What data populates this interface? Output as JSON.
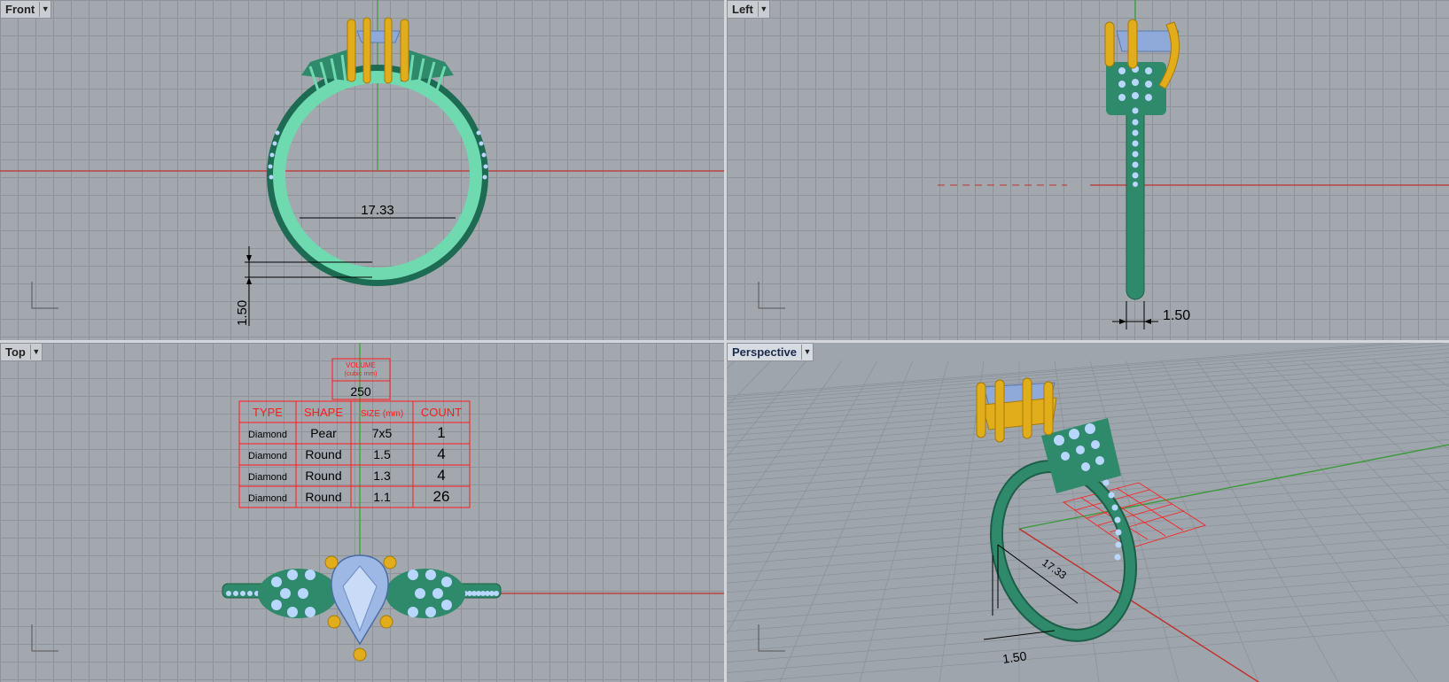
{
  "viewports": {
    "front": {
      "label": "Front",
      "dim_width": "17.33",
      "dim_thickness": "1.50"
    },
    "left": {
      "label": "Left",
      "dim_thickness": "1.50"
    },
    "top": {
      "label": "Top"
    },
    "perspective": {
      "label": "Perspective",
      "dim_width": "17.33",
      "dim_thickness": "1.50"
    }
  },
  "volume_box": {
    "title": "VOLUME",
    "unit": "(cubic mm)",
    "value": "250"
  },
  "stone_table": {
    "headers": [
      "TYPE",
      "SHAPE",
      "SIZE (mm)",
      "COUNT"
    ],
    "rows": [
      [
        "Diamond",
        "Pear",
        "7x5",
        "1"
      ],
      [
        "Diamond",
        "Round",
        "1.5",
        "4"
      ],
      [
        "Diamond",
        "Round",
        "1.3",
        "4"
      ],
      [
        "Diamond",
        "Round",
        "1.1",
        "26"
      ]
    ]
  },
  "colors": {
    "band": "#2e8a6a",
    "band_light": "#6fd9b0",
    "prong": "#e2ad1a",
    "gem": "#8fa9d8",
    "annotation": "#ff1a1a",
    "axis_x": "#c0302a",
    "axis_y": "#3a9a3a"
  }
}
